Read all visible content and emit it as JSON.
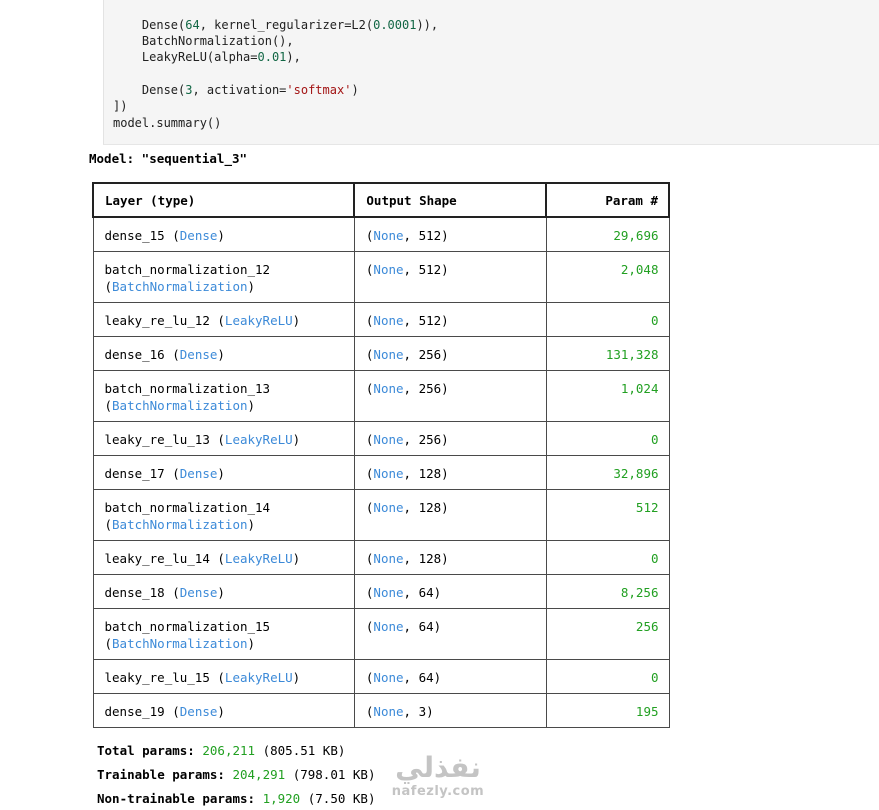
{
  "code": {
    "lines": [
      "    Dense(64, kernel_regularizer=L2(0.0001)),",
      "    BatchNormalization(),",
      "    LeakyReLU(alpha=0.01),",
      "",
      "    Dense(3, activation='softmax')",
      "])",
      "model.summary()"
    ]
  },
  "model_title": "Model: \"sequential_3\"",
  "table": {
    "headers": {
      "layer": "Layer (type)",
      "shape": "Output Shape",
      "param": "Param #"
    },
    "rows": [
      {
        "name": "dense_15",
        "type": "Dense",
        "shape_dim": "512",
        "params": "29,696"
      },
      {
        "name": "batch_normalization_12",
        "type": "BatchNormalization",
        "shape_dim": "512",
        "params": "2,048"
      },
      {
        "name": "leaky_re_lu_12",
        "type": "LeakyReLU",
        "shape_dim": "512",
        "params": "0"
      },
      {
        "name": "dense_16",
        "type": "Dense",
        "shape_dim": "256",
        "params": "131,328"
      },
      {
        "name": "batch_normalization_13",
        "type": "BatchNormalization",
        "shape_dim": "256",
        "params": "1,024"
      },
      {
        "name": "leaky_re_lu_13",
        "type": "LeakyReLU",
        "shape_dim": "256",
        "params": "0"
      },
      {
        "name": "dense_17",
        "type": "Dense",
        "shape_dim": "128",
        "params": "32,896"
      },
      {
        "name": "batch_normalization_14",
        "type": "BatchNormalization",
        "shape_dim": "128",
        "params": "512"
      },
      {
        "name": "leaky_re_lu_14",
        "type": "LeakyReLU",
        "shape_dim": "128",
        "params": "0"
      },
      {
        "name": "dense_18",
        "type": "Dense",
        "shape_dim": "64",
        "params": "8,256"
      },
      {
        "name": "batch_normalization_15",
        "type": "BatchNormalization",
        "shape_dim": "64",
        "params": "256"
      },
      {
        "name": "leaky_re_lu_15",
        "type": "LeakyReLU",
        "shape_dim": "64",
        "params": "0"
      },
      {
        "name": "dense_19",
        "type": "Dense",
        "shape_dim": "3",
        "params": "195"
      }
    ],
    "none_label": "None"
  },
  "totals": {
    "total": {
      "label": "Total params:",
      "value": "206,211",
      "size": "(805.51 KB)"
    },
    "trainable": {
      "label": "Trainable params:",
      "value": "204,291",
      "size": "(798.01 KB)"
    },
    "non_trainable": {
      "label": "Non-trainable params:",
      "value": "1,920",
      "size": "(7.50 KB)"
    }
  },
  "watermark": {
    "arabic": "نفذلي",
    "latin": "nafezly.com"
  },
  "colors": {
    "type_blue": "#3c8ad8",
    "param_green": "#22a022",
    "code_bg": "#f5f5f5"
  }
}
